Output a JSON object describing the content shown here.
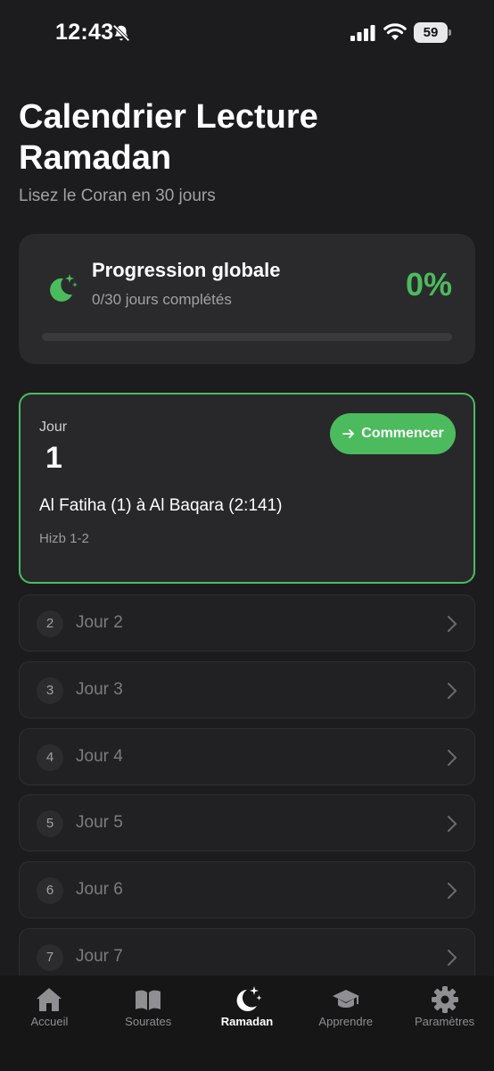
{
  "status_bar": {
    "time": "12:43",
    "battery": "59"
  },
  "header": {
    "title": "Calendrier Lecture Ramadan",
    "subtitle": "Lisez le Coran en 30 jours"
  },
  "progress": {
    "title": "Progression globale",
    "completed_text": "0/30 jours complétés",
    "percent_text": "0%",
    "fraction": 0
  },
  "active_day": {
    "label": "Jour",
    "number": "1",
    "button_label": "Commencer",
    "range": "Al Fatiha (1) à Al Baqara (2:141)",
    "hizb": "Hizb 1-2"
  },
  "days": [
    {
      "number": "2",
      "label": "Jour 2"
    },
    {
      "number": "3",
      "label": "Jour 3"
    },
    {
      "number": "4",
      "label": "Jour 4"
    },
    {
      "number": "5",
      "label": "Jour 5"
    },
    {
      "number": "6",
      "label": "Jour 6"
    },
    {
      "number": "7",
      "label": "Jour 7"
    }
  ],
  "tabs": [
    {
      "label": "Accueil",
      "icon": "home-icon",
      "active": false
    },
    {
      "label": "Sourates",
      "icon": "book-icon",
      "active": false
    },
    {
      "label": "Ramadan",
      "icon": "moon-stars-icon",
      "active": true
    },
    {
      "label": "Apprendre",
      "icon": "graduation-cap-icon",
      "active": false
    },
    {
      "label": "Paramètres",
      "icon": "gear-icon",
      "active": false
    }
  ],
  "colors": {
    "accent": "#4cbb5e",
    "background": "#1c1c1e",
    "card": "#2a2a2c"
  }
}
